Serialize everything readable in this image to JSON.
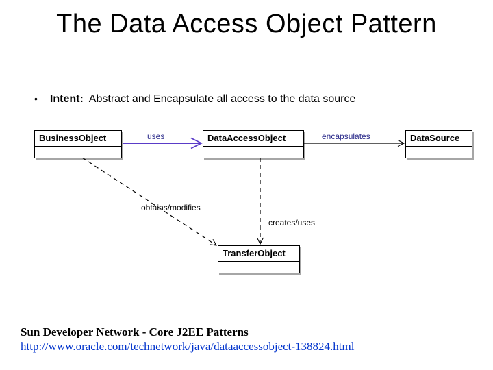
{
  "title": "The Data Access Object Pattern",
  "intent": {
    "label": "Intent:",
    "text": "Abstract and Encapsulate all access to the data source"
  },
  "diagram": {
    "classes": {
      "business_object": "BusinessObject",
      "data_access_object": "DataAccessObject",
      "data_source": "DataSource",
      "transfer_object": "TransferObject"
    },
    "relations": {
      "uses": "uses",
      "encapsulates": "encapsulates",
      "obtains_modifies": "obtains/modifies",
      "creates_uses": "creates/uses"
    }
  },
  "footer": {
    "source": "Sun Developer Network - Core J2EE Patterns",
    "link_text": "http://www.oracle.com/technetwork/java/dataaccessobject-138824.html",
    "link_href": "http://www.oracle.com/technetwork/java/dataaccessobject-138824.html"
  },
  "colors": {
    "uses_line": "#5a3cc8",
    "relation_text": "#2a2a8a"
  }
}
